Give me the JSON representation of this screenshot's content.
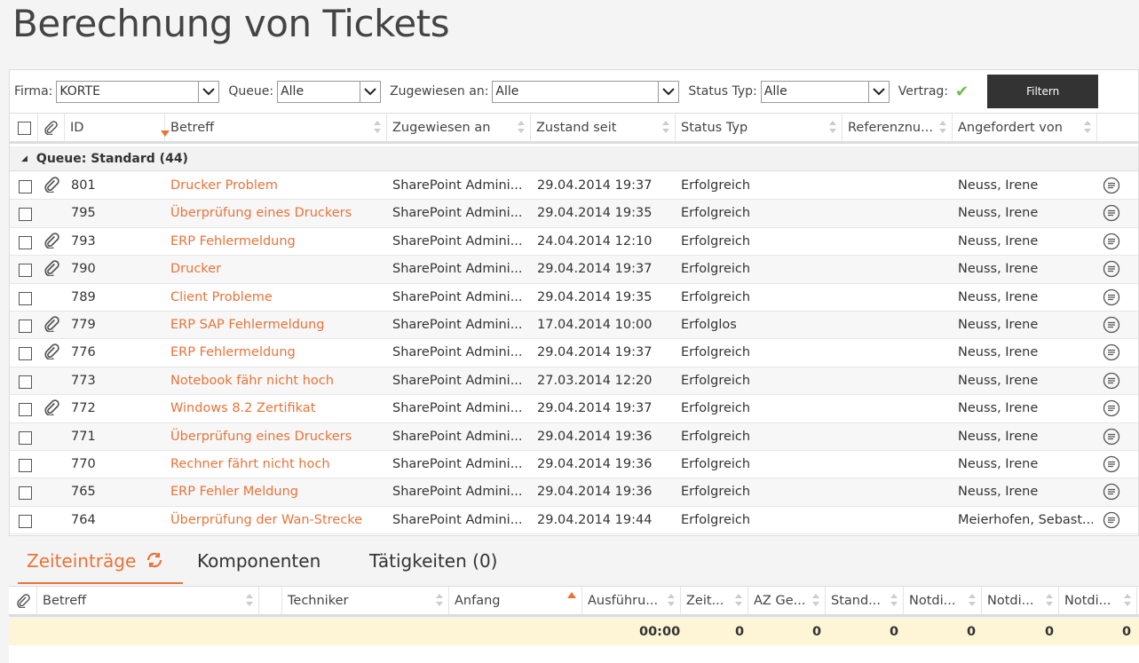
{
  "page": {
    "title": "Berechnung von Tickets"
  },
  "filters": {
    "firma_label": "Firma:",
    "firma_value": "KORTE",
    "queue_label": "Queue:",
    "queue_value": "Alle",
    "assigned_label": "Zugewiesen an:",
    "assigned_value": "Alle",
    "status_label": "Status Typ:",
    "status_value": "Alle",
    "contract_label": "Vertrag:",
    "filter_button": "Filtern"
  },
  "grid": {
    "columns": [
      "ID",
      "Betreff",
      "Zugewiesen an",
      "Zustand seit",
      "Status Typ",
      "Referenznu...",
      "Angefordert von"
    ],
    "group_label": "Queue: Standard (44)",
    "rows": [
      {
        "id": "801",
        "subject": "Drucker Problem",
        "assigned": "SharePoint Admini...",
        "since": "29.04.2014 19:37",
        "status": "Erfolgreich",
        "requester": "Neuss, Irene",
        "attachment": true
      },
      {
        "id": "795",
        "subject": "Überprüfung eines Druckers",
        "assigned": "SharePoint Admini...",
        "since": "29.04.2014 19:35",
        "status": "Erfolgreich",
        "requester": "Neuss, Irene",
        "attachment": false
      },
      {
        "id": "793",
        "subject": "ERP Fehlermeldung",
        "assigned": "SharePoint Admini...",
        "since": "24.04.2014 12:10",
        "status": "Erfolgreich",
        "requester": "Neuss, Irene",
        "attachment": true
      },
      {
        "id": "790",
        "subject": "Drucker",
        "assigned": "SharePoint Admini...",
        "since": "29.04.2014 19:37",
        "status": "Erfolgreich",
        "requester": "Neuss, Irene",
        "attachment": true
      },
      {
        "id": "789",
        "subject": "Client Probleme",
        "assigned": "SharePoint Admini...",
        "since": "29.04.2014 19:35",
        "status": "Erfolgreich",
        "requester": "Neuss, Irene",
        "attachment": false
      },
      {
        "id": "779",
        "subject": "ERP SAP Fehlermeldung",
        "assigned": "SharePoint Admini...",
        "since": "17.04.2014 10:00",
        "status": "Erfolglos",
        "requester": "Neuss, Irene",
        "attachment": true
      },
      {
        "id": "776",
        "subject": "ERP Fehlermeldung",
        "assigned": "SharePoint Admini...",
        "since": "29.04.2014 19:37",
        "status": "Erfolgreich",
        "requester": "Neuss, Irene",
        "attachment": true
      },
      {
        "id": "773",
        "subject": "Notebook fähr nicht hoch",
        "assigned": "SharePoint Admini...",
        "since": "27.03.2014 12:20",
        "status": "Erfolgreich",
        "requester": "Neuss, Irene",
        "attachment": false
      },
      {
        "id": "772",
        "subject": "Windows 8.2 Zertifikat",
        "assigned": "SharePoint Admini...",
        "since": "29.04.2014 19:37",
        "status": "Erfolgreich",
        "requester": "Neuss, Irene",
        "attachment": true
      },
      {
        "id": "771",
        "subject": "Überprüfung eines Druckers",
        "assigned": "SharePoint Admini...",
        "since": "29.04.2014 19:36",
        "status": "Erfolgreich",
        "requester": "Neuss, Irene",
        "attachment": false
      },
      {
        "id": "770",
        "subject": "Rechner fährt nicht hoch",
        "assigned": "SharePoint Admini...",
        "since": "29.04.2014 19:36",
        "status": "Erfolgreich",
        "requester": "Neuss, Irene",
        "attachment": false
      },
      {
        "id": "765",
        "subject": "ERP Fehler Meldung",
        "assigned": "SharePoint Admini...",
        "since": "29.04.2014 19:36",
        "status": "Erfolgreich",
        "requester": "Neuss, Irene",
        "attachment": false
      },
      {
        "id": "764",
        "subject": "Überprüfung der Wan-Strecke",
        "assigned": "SharePoint Admini...",
        "since": "29.04.2014 19:44",
        "status": "Erfolgreich",
        "requester": "Meierhofen, Sebast...",
        "attachment": false
      }
    ]
  },
  "tabs": [
    {
      "label": "Zeiteinträge"
    },
    {
      "label": "Komponenten"
    },
    {
      "label": "Tätigkeiten (0)"
    }
  ],
  "time_grid": {
    "columns": [
      "Betreff",
      "Techniker",
      "Anfang",
      "Ausführu...",
      "Zeit...",
      "AZ Ge...",
      "Stand...",
      "Notdi...",
      "Notdi...",
      "Notdi..."
    ],
    "totals": [
      "00:00",
      "0",
      "0",
      "0",
      "0",
      "0",
      "0"
    ]
  },
  "colors": {
    "accent": "#e8733a",
    "check": "#6cc04a",
    "button_bg": "#333333",
    "totals_bg": "#fdf5d6"
  }
}
